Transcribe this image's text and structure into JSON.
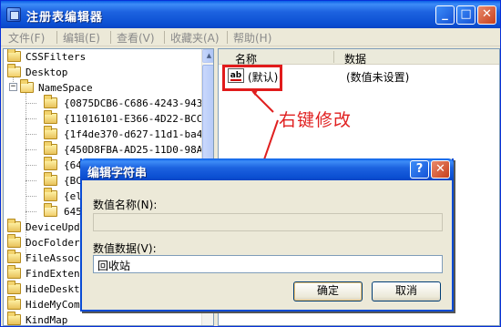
{
  "window": {
    "title": "注册表编辑器",
    "controls": [
      "_",
      "□",
      "✕"
    ]
  },
  "menu": [
    "文件(F)",
    "编辑(E)",
    "查看(V)",
    "收藏夹(A)",
    "帮助(H)"
  ],
  "tree": {
    "items": [
      {
        "label": "CSSFilters",
        "level": 0
      },
      {
        "label": "Desktop",
        "level": 0
      },
      {
        "label": "NameSpace",
        "level": 1
      },
      {
        "label": "{0875DCB6-C686-4243-943",
        "level": 2
      },
      {
        "label": "{11016101-E366-4D22-BCC",
        "level": 2
      },
      {
        "label": "{1f4de370-d627-11d1-ba4",
        "level": 2
      },
      {
        "label": "{450D8FBA-AD25-11D0-98A",
        "level": 2
      },
      {
        "label": "{645",
        "level": 2
      },
      {
        "label": "{BC",
        "level": 2
      },
      {
        "label": "{el",
        "level": 2
      },
      {
        "label": "645",
        "level": 2
      },
      {
        "label": "DeviceUpd",
        "level": 0
      },
      {
        "label": "DocFolder",
        "level": 0
      },
      {
        "label": "FileAssoc",
        "level": 0
      },
      {
        "label": "FindExten",
        "level": 0
      },
      {
        "label": "HideDeskt",
        "level": 0
      },
      {
        "label": "HideMyCom",
        "level": 0
      },
      {
        "label": "KindMap",
        "level": 0
      }
    ]
  },
  "values_pane": {
    "col_name": "名称",
    "col_data": "数据",
    "row": {
      "icon": "ab",
      "name": "(默认)",
      "data": "(数值未设置)"
    }
  },
  "annotation": {
    "text": "右键修改",
    "color": "#e02020"
  },
  "dialog": {
    "title": "编辑字符串",
    "help_btn": "?",
    "close_btn": "✕",
    "name_label": "数值名称(N):",
    "name_value": "",
    "data_label": "数值数据(V):",
    "data_value": "回收站",
    "ok_label": "确定",
    "cancel_label": "取消"
  }
}
